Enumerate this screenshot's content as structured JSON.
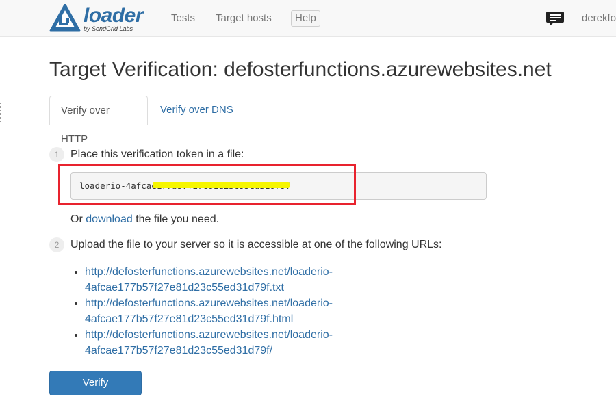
{
  "navbar": {
    "logo_word": "loader",
    "logo_sub": "by SendGrid Labs",
    "links": [
      "Tests",
      "Target hosts"
    ],
    "help": "Help",
    "user": "derekfos"
  },
  "page": {
    "title": "Target Verification: defosterfunctions.azurewebsites.net"
  },
  "tabs": {
    "active": "Verify over HTTP",
    "inactive": "Verify over DNS"
  },
  "step1": {
    "number": "1",
    "text": "Place this verification token in a file:",
    "token": "loaderio-4afcae177b57f27e81d23c55ed31d79f",
    "or_prefix": "Or",
    "download_link": "download",
    "or_suffix": "the file you need."
  },
  "step2": {
    "number": "2",
    "text": "Upload the file to your server so it is accessible at one of the following URLs:",
    "urls": [
      {
        "line1": "http://defosterfunctions.azurewebsites.net/loaderio-",
        "line2": "4afcae177b57f27e81d23c55ed31d79f.txt"
      },
      {
        "line1": "http://defosterfunctions.azurewebsites.net/loaderio-",
        "line2": "4afcae177b57f27e81d23c55ed31d79f.html"
      },
      {
        "line1": "http://defosterfunctions.azurewebsites.net/loaderio-",
        "line2": "4afcae177b57f27e81d23c55ed31d79f/"
      }
    ]
  },
  "verify_button": "Verify",
  "colors": {
    "brand": "#2f6ea5",
    "primary_button": "#337ab7",
    "annotation_red": "#e8232e",
    "redaction_yellow": "#f6f600"
  },
  "icons": {
    "logo": "loader-logo-icon",
    "chat": "chat-bubble-icon"
  }
}
